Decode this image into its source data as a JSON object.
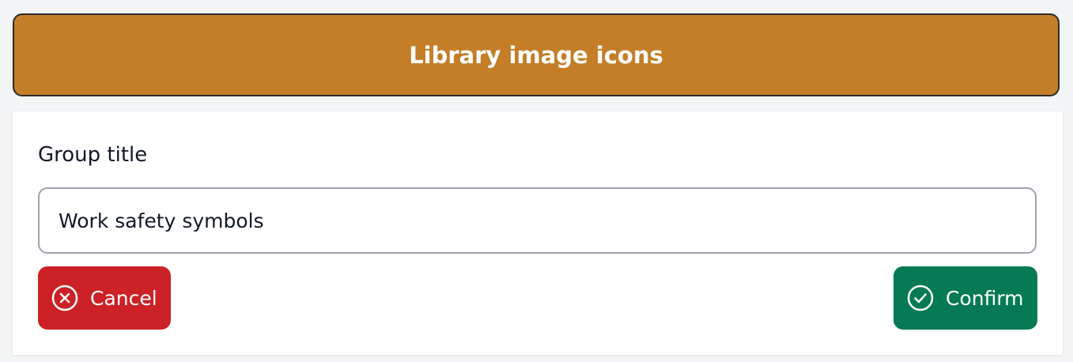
{
  "header": {
    "title": "Library image icons",
    "color": "#c47e28"
  },
  "form": {
    "label": "Group title",
    "input_value": "Work safety symbols"
  },
  "actions": {
    "cancel": {
      "label": "Cancel",
      "icon": "circle-x-icon",
      "color": "#cc2126"
    },
    "confirm": {
      "label": "Confirm",
      "icon": "circle-check-icon",
      "color": "#067a55"
    }
  }
}
